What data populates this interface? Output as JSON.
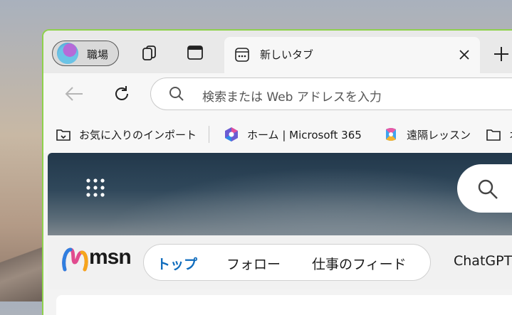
{
  "profile": {
    "label": "職場"
  },
  "tabs": [
    {
      "title": "新しいタブ"
    }
  ],
  "address": {
    "placeholder": "検索または Web アドレスを入力"
  },
  "favorites": [
    {
      "label": "お気に入りのインポート",
      "icon": "import-favorites-icon"
    },
    {
      "label": "ホーム | Microsoft 365",
      "icon": "microsoft365-icon"
    },
    {
      "label": "遠隔レッスン",
      "icon": "copilot-icon"
    },
    {
      "label": "オ",
      "icon": "folder-icon"
    }
  ],
  "msn": {
    "brand": "msn",
    "nav": [
      {
        "label": "トップ",
        "active": true
      },
      {
        "label": "フォロー"
      },
      {
        "label": "仕事のフィード"
      }
    ],
    "extra": "ChatGPT"
  },
  "colors": {
    "window_border": "#8ed14c",
    "active_nav": "#0f6cbd"
  }
}
